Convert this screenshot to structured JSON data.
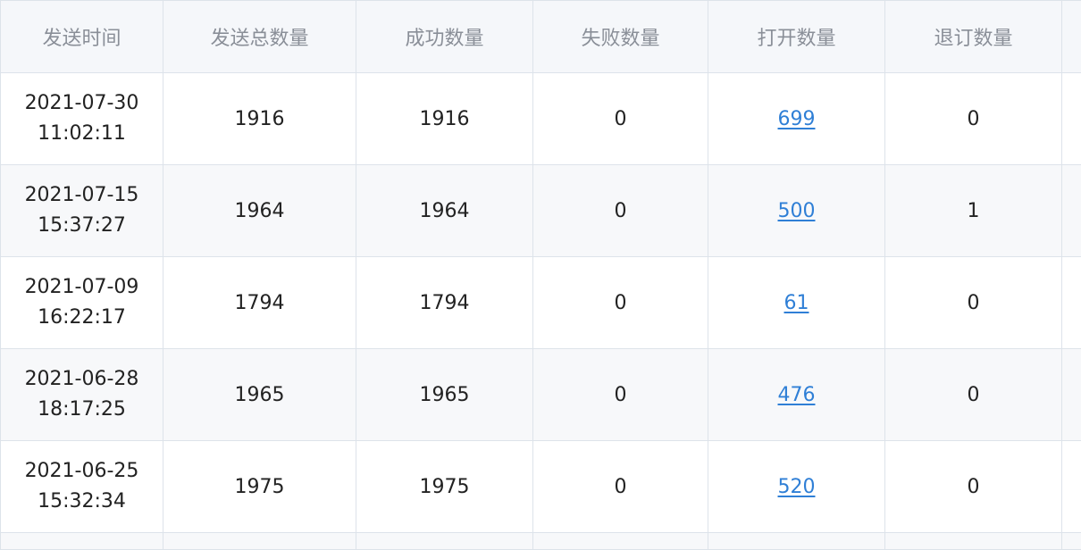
{
  "colors": {
    "link": "#2f7fd6",
    "header_text": "#8a8f98",
    "border": "#dde3ea"
  },
  "table": {
    "headers": [
      "发送时间",
      "发送总数量",
      "成功数量",
      "失败数量",
      "打开数量",
      "退订数量"
    ],
    "rows": [
      {
        "date": "2021-07-30",
        "time": "11:02:11",
        "total": "1916",
        "success": "1916",
        "failed": "0",
        "opened": "699",
        "unsubscribed": "0"
      },
      {
        "date": "2021-07-15",
        "time": "15:37:27",
        "total": "1964",
        "success": "1964",
        "failed": "0",
        "opened": "500",
        "unsubscribed": "1"
      },
      {
        "date": "2021-07-09",
        "time": "16:22:17",
        "total": "1794",
        "success": "1794",
        "failed": "0",
        "opened": "61",
        "unsubscribed": "0"
      },
      {
        "date": "2021-06-28",
        "time": "18:17:25",
        "total": "1965",
        "success": "1965",
        "failed": "0",
        "opened": "476",
        "unsubscribed": "0"
      },
      {
        "date": "2021-06-25",
        "time": "15:32:34",
        "total": "1975",
        "success": "1975",
        "failed": "0",
        "opened": "520",
        "unsubscribed": "0"
      }
    ]
  }
}
